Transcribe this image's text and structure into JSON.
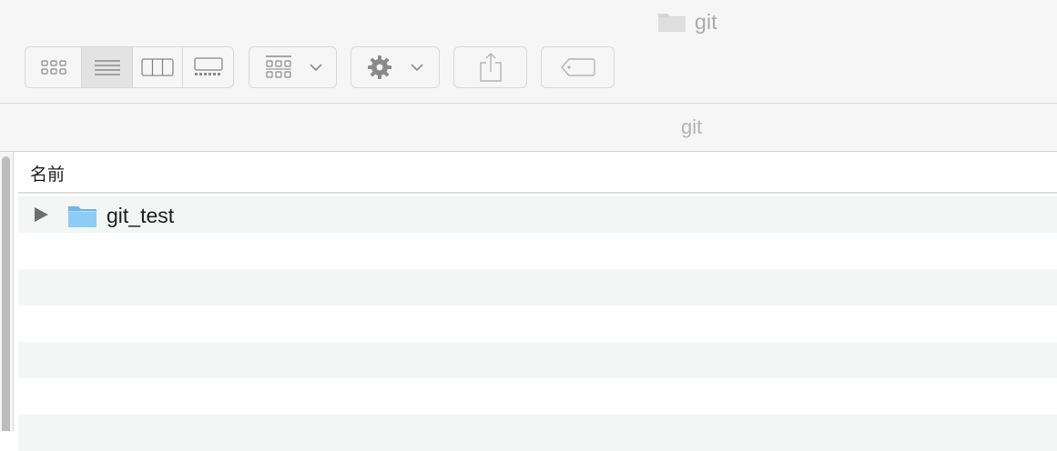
{
  "window": {
    "title": "git",
    "title_icon": "folder-icon"
  },
  "toolbar": {
    "view_modes": [
      {
        "name": "icon-view",
        "icon": "grid-icon",
        "active": false
      },
      {
        "name": "list-view",
        "icon": "list-icon",
        "active": true
      },
      {
        "name": "column-view",
        "icon": "columns-icon",
        "active": false
      },
      {
        "name": "gallery-view",
        "icon": "gallery-icon",
        "active": false
      }
    ],
    "group_menu_icon": "group-grid-icon",
    "action_menu_icon": "gear-icon",
    "share_icon": "share-icon",
    "tag_icon": "tag-icon"
  },
  "pathbar": {
    "label": "git"
  },
  "list": {
    "column_header": "名前",
    "items": [
      {
        "name": "git_test",
        "type": "folder",
        "expanded": false
      }
    ]
  },
  "colors": {
    "folder_blue": "#7cc1f2",
    "row_stripe": "#f4f5f5",
    "scrollbar": "#bdbdbd"
  }
}
